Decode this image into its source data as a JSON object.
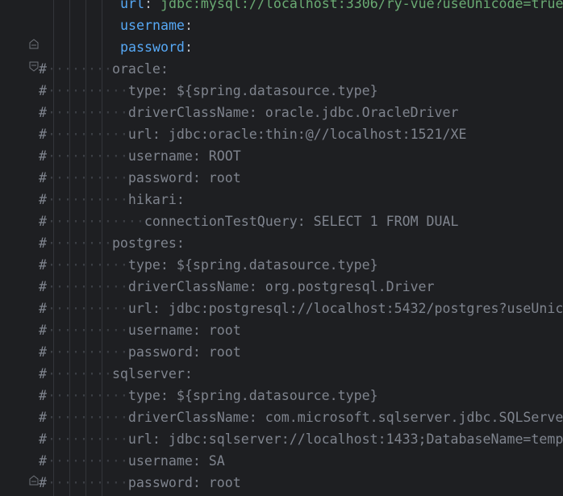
{
  "editor": {
    "top_lines": [
      {
        "key": "url",
        "sep": ": ",
        "value": "jdbc:mysql://localhost:3306/ry-vue?useUnicode=true"
      },
      {
        "key": "username",
        "sep": ":",
        "value": ""
      },
      {
        "key": "password",
        "sep": ":",
        "value": ""
      }
    ],
    "comment_lines": [
      {
        "hash": "#",
        "dots": "········",
        "text": "oracle:"
      },
      {
        "hash": "#",
        "dots": "··········",
        "text": "type: ${spring.datasource.type}"
      },
      {
        "hash": "#",
        "dots": "··········",
        "text": "driverClassName: oracle.jdbc.OracleDriver"
      },
      {
        "hash": "#",
        "dots": "··········",
        "text": "url: jdbc:oracle:thin:@//localhost:1521/XE"
      },
      {
        "hash": "#",
        "dots": "··········",
        "text": "username: ROOT"
      },
      {
        "hash": "#",
        "dots": "··········",
        "text": "password: root"
      },
      {
        "hash": "#",
        "dots": "··········",
        "text": "hikari:"
      },
      {
        "hash": "#",
        "dots": "············",
        "text": "connectionTestQuery: SELECT 1 FROM DUAL"
      },
      {
        "hash": "#",
        "dots": "········",
        "text": "postgres:"
      },
      {
        "hash": "#",
        "dots": "··········",
        "text": "type: ${spring.datasource.type}"
      },
      {
        "hash": "#",
        "dots": "··········",
        "text": "driverClassName: org.postgresql.Driver"
      },
      {
        "hash": "#",
        "dots": "··········",
        "text": "url: jdbc:postgresql://localhost:5432/postgres?useUnic"
      },
      {
        "hash": "#",
        "dots": "··········",
        "text": "username: root"
      },
      {
        "hash": "#",
        "dots": "··········",
        "text": "password: root"
      },
      {
        "hash": "#",
        "dots": "········",
        "text": "sqlserver:"
      },
      {
        "hash": "#",
        "dots": "··········",
        "text": "type: ${spring.datasource.type}"
      },
      {
        "hash": "#",
        "dots": "··········",
        "text": "driverClassName: com.microsoft.sqlserver.jdbc.SQLServe"
      },
      {
        "hash": "#",
        "dots": "··········",
        "text": "url: jdbc:sqlserver://localhost:1433;DatabaseName=temp"
      },
      {
        "hash": "#",
        "dots": "··········",
        "text": "username: SA"
      },
      {
        "hash": "#",
        "dots": "··········",
        "text": "password: root"
      }
    ]
  },
  "colors": {
    "background": "#1e1f22",
    "comment": "#7f848e",
    "key": "#56a8f5",
    "string": "#6aab73",
    "whitespace_dot": "#3c3f45",
    "indent_guide": "#33353a"
  },
  "icons": {
    "fold_end": "fold-end-icon",
    "fold_start": "fold-start-icon"
  }
}
